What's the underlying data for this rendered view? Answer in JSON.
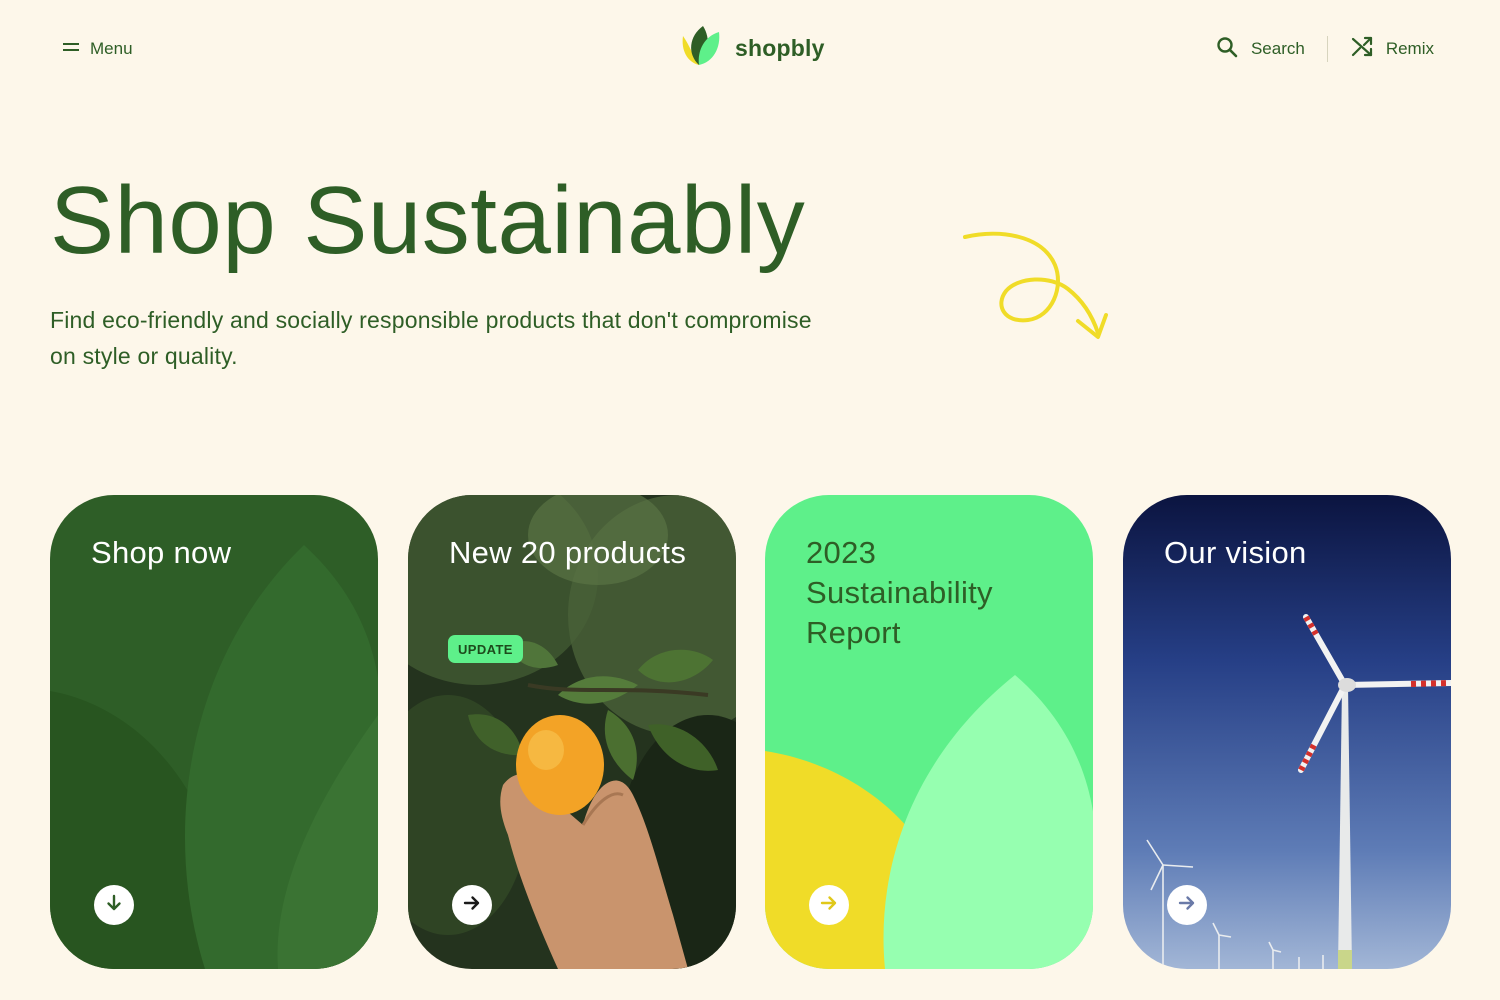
{
  "header": {
    "menu_label": "Menu",
    "brand_name": "shopbly",
    "search_label": "Search",
    "remix_label": "Remix"
  },
  "hero": {
    "title": "Shop Sustainably",
    "subtitle": "Find eco-friendly and socially responsible products that don't compromise on style or quality."
  },
  "cards": [
    {
      "title": "Shop now",
      "button_icon": "arrow-down-icon"
    },
    {
      "title": "New 20 products",
      "badge": "UPDATE",
      "button_icon": "arrow-right-icon"
    },
    {
      "title": "2023 Sustainability Report",
      "button_icon": "arrow-right-icon"
    },
    {
      "title": "Our vision",
      "button_icon": "arrow-right-icon"
    }
  ],
  "colors": {
    "background": "#fdf7ea",
    "brand_green": "#2e5e26",
    "bright_green": "#5ef08a",
    "yellow": "#f0dc28",
    "navy": "#0f1a45"
  }
}
